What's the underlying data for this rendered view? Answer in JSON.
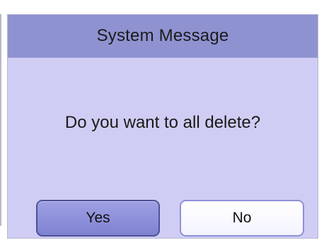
{
  "dialog": {
    "title": "System Message",
    "message": "Do you want to all delete?",
    "buttons": {
      "yes_label": "Yes",
      "no_label": "No"
    }
  },
  "colors": {
    "title_bar": "#8f92d0",
    "dialog_background": "#cfcdf4",
    "yes_button": "#8a8cd8",
    "no_button": "#ffffff"
  }
}
